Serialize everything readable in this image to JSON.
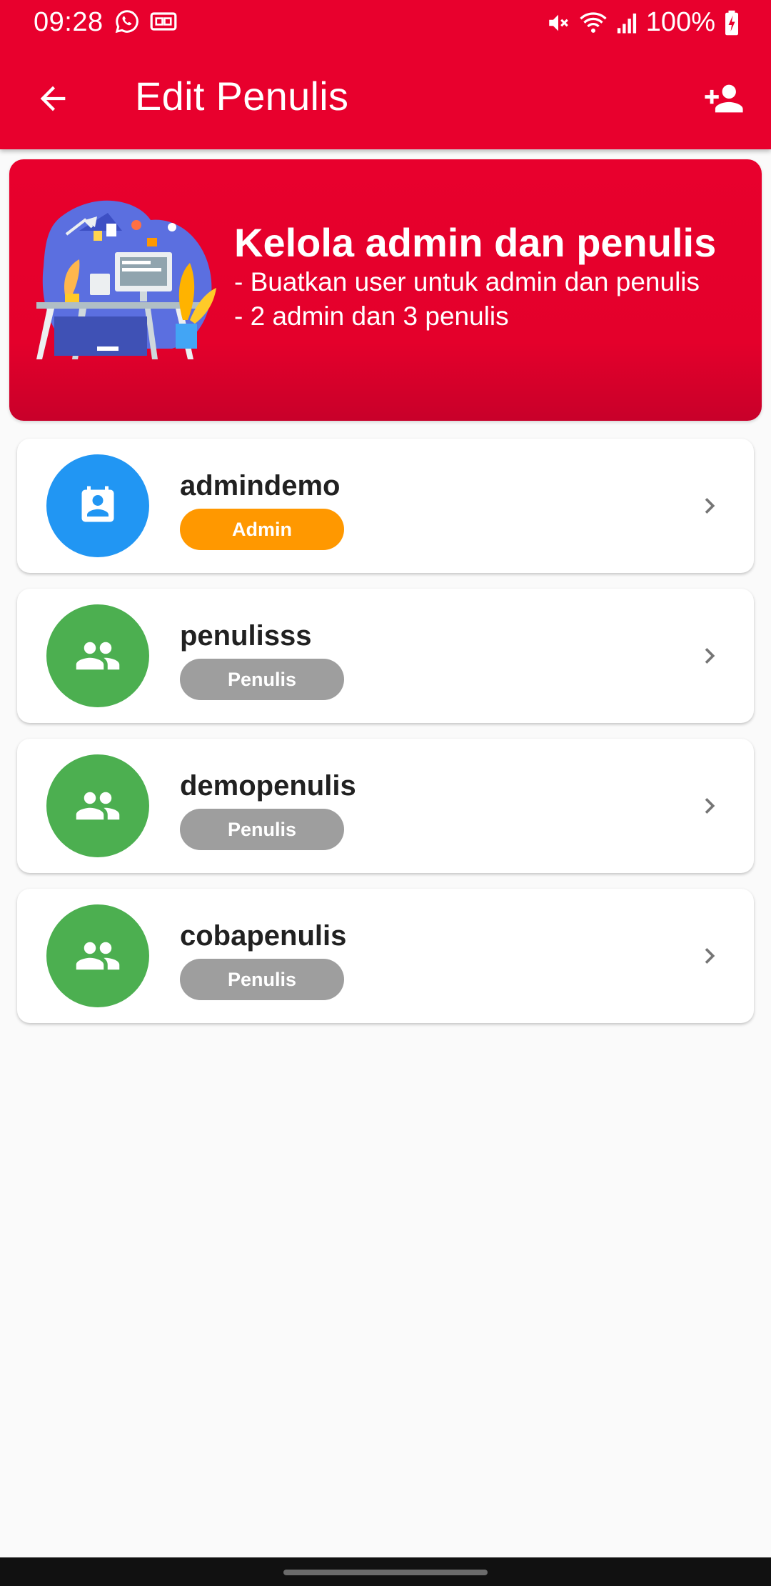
{
  "status_bar": {
    "time": "09:28",
    "battery": "100%",
    "icons": [
      "whatsapp-icon",
      "cast-icon",
      "mute-icon",
      "wifi-icon",
      "signal-icon",
      "battery-charging-icon"
    ]
  },
  "app_bar": {
    "title": "Edit Penulis",
    "back_icon": "arrow-back-icon",
    "action_icon": "person-add-icon"
  },
  "banner": {
    "title": "Kelola admin dan penulis",
    "lines": [
      "- Buatkan user untuk admin dan penulis",
      "- 2 admin dan 3 penulis"
    ],
    "illustration": "workspace-desk-illustration"
  },
  "users": [
    {
      "name": "admindemo",
      "role": "Admin",
      "avatar_icon": "contact-card-icon",
      "avatar_color": "#2196f3",
      "badge_color": "#ff9800"
    },
    {
      "name": "penulisss",
      "role": "Penulis",
      "avatar_icon": "group-icon",
      "avatar_color": "#4caf50",
      "badge_color": "#9e9e9e"
    },
    {
      "name": "demopenulis",
      "role": "Penulis",
      "avatar_icon": "group-icon",
      "avatar_color": "#4caf50",
      "badge_color": "#9e9e9e"
    },
    {
      "name": "cobapenulis",
      "role": "Penulis",
      "avatar_icon": "group-icon",
      "avatar_color": "#4caf50",
      "badge_color": "#9e9e9e"
    }
  ],
  "colors": {
    "primary": "#e8002d",
    "background": "#fafafa",
    "card": "#ffffff",
    "text": "#212121",
    "chevron": "#757575"
  }
}
